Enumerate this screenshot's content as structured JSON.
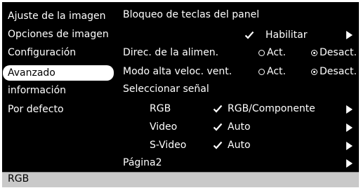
{
  "menu": {
    "items": [
      {
        "label": "Ajuste de la imagen"
      },
      {
        "label": "Opciones de imagen"
      },
      {
        "label": "Configuración"
      },
      {
        "label": "Avanzado"
      },
      {
        "label": "información"
      },
      {
        "label": "Por defecto"
      }
    ],
    "selected_index": 3
  },
  "content": {
    "panel_lock": {
      "label": "Bloqueo de teclas del panel",
      "option": "Habilitar",
      "checked": true
    },
    "power_direct": {
      "label": "Direc. de la alimen.",
      "on_label": "Act.",
      "off_label": "Desact.",
      "value": "Desact."
    },
    "fan_mode": {
      "label": "Modo alta veloc. vent.",
      "on_label": "Act.",
      "off_label": "Desact.",
      "value": "Desact."
    },
    "signal_select": {
      "label": "Seleccionar señal",
      "rows": [
        {
          "name": "RGB",
          "value": "RGB/Componente"
        },
        {
          "name": "Video",
          "value": "Auto"
        },
        {
          "name": "S-Video",
          "value": "Auto"
        }
      ]
    },
    "page2": {
      "label": "Página2"
    }
  },
  "status": {
    "text": "RGB"
  },
  "colors": {
    "background": "#000000",
    "text": "#ffffff",
    "status_bar": "#c9c9c9",
    "selection": "#ffffff"
  },
  "icons": {
    "check": "checkmark-icon",
    "arrow": "right-triangle-icon",
    "radio": "radio-button-icon"
  }
}
